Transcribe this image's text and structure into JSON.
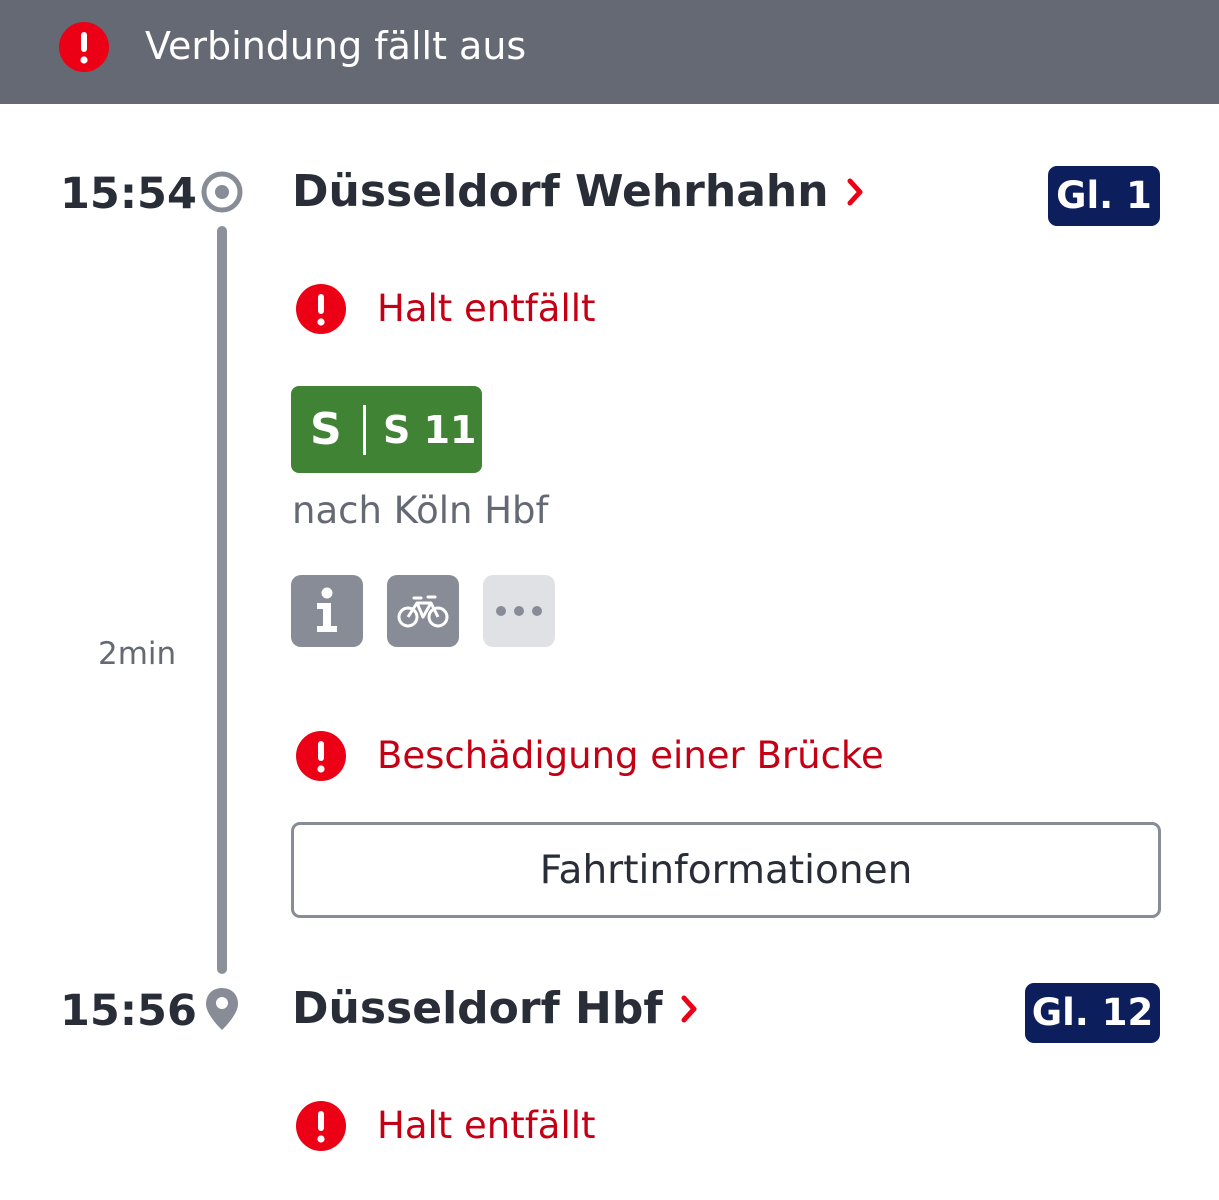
{
  "banner": {
    "text": "Verbindung fällt aus",
    "icon": "alert-circle-icon",
    "background": "#646973"
  },
  "colors": {
    "alert_red": "#ec0016",
    "warning_text": "#c50014",
    "platform_badge": "#0c1e5c",
    "sbahn_green": "#408335",
    "timeline": "#8b909a"
  },
  "departure": {
    "time": "15:54",
    "station": "Düsseldorf Wehrhahn",
    "platform": "Gl. 1",
    "warning": "Halt entfällt",
    "icon": "origin-circle-icon"
  },
  "journey": {
    "duration": "2min",
    "product_logo": "S",
    "line": "S 11",
    "direction": "nach Köln Hbf",
    "icons": [
      "info-icon",
      "bicycle-icon",
      "more-icon"
    ],
    "notice": "Beschädigung einer Brücke",
    "button_label": "Fahrtinformationen"
  },
  "arrival": {
    "time": "15:56",
    "station": "Düsseldorf Hbf",
    "platform": "Gl. 12",
    "warning": "Halt entfällt",
    "icon": "location-pin-icon"
  }
}
